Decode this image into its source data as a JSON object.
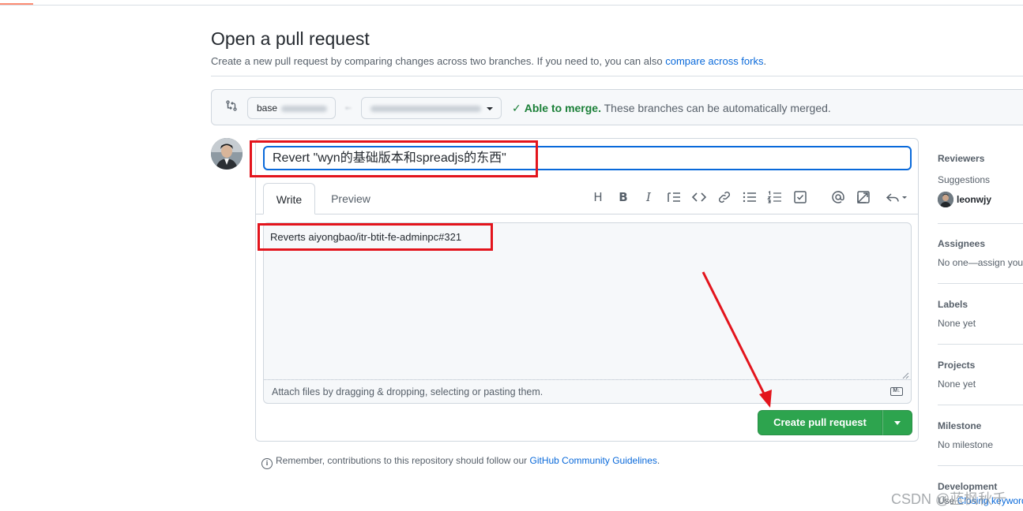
{
  "header": {
    "title": "Open a pull request",
    "subtitle": "Create a new pull request by comparing changes across two branches. If you need to, you can also ",
    "subtitle_link": "compare across forks",
    "subtitle_end": "."
  },
  "range": {
    "base_label": "base",
    "merge_ok": "Able to merge.",
    "merge_detail": " These branches can be automatically merged."
  },
  "form": {
    "title_value": "Revert \"wyn的基础版本和spreadjs的东西\"",
    "tabs": [
      {
        "label": "Write"
      },
      {
        "label": "Preview"
      }
    ],
    "body_value": "Reverts aiyongbao/itr-btit-fe-adminpc#321",
    "attach_hint": "Attach files by dragging & dropping, selecting or pasting them.",
    "submit_label": "Create pull request"
  },
  "toolbar": {
    "heading": "H",
    "bold": "B",
    "italic": "I"
  },
  "footer": {
    "text": "Remember, contributions to this repository should follow our ",
    "link": "GitHub Community Guidelines",
    "end": "."
  },
  "sidebar": {
    "reviewers": {
      "heading": "Reviewers",
      "sub": "Suggestions",
      "user": "leonwjy"
    },
    "assignees": {
      "heading": "Assignees",
      "value": "No one—assign you"
    },
    "labels": {
      "heading": "Labels",
      "value": "None yet"
    },
    "projects": {
      "heading": "Projects",
      "value": "None yet"
    },
    "milestone": {
      "heading": "Milestone",
      "value": "No milestone"
    },
    "development": {
      "heading": "Development",
      "value": "Use ",
      "link": "Closing keyword"
    }
  },
  "watermark": "CSDN @蓝枫秋千",
  "colors": {
    "primary_button": "#2da44e",
    "link": "#0969da",
    "success": "#1a7f37",
    "annotation": "#e3141c"
  }
}
